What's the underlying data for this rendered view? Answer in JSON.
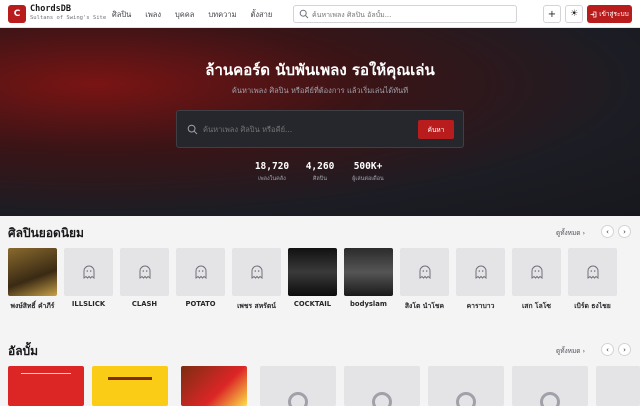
{
  "brand": {
    "logo_letter": "C",
    "name": "ChordsDB",
    "tagline": "Sultans of Swing's Site"
  },
  "nav": [
    "ศิลปิน",
    "เพลง",
    "บุคคล",
    "บทความ",
    "ตั้งสาย"
  ],
  "search": {
    "placeholder": "ค้นหาเพลง ศิลปิน อัลบั้ม..."
  },
  "header_buttons": {
    "add": "+",
    "theme": "☀",
    "login": "เข้าสู่ระบบ"
  },
  "hero": {
    "title": "ล้านคอร์ด นับพันเพลง รอให้คุณเล่น",
    "subtitle": "ค้นหาเพลง ศิลปิน หรือคีย์ที่ต้องการ แล้วเริ่มเล่นได้ทันที",
    "search_placeholder": "ค้นหาเพลง ศิลปิน หรือคีย์...",
    "search_button": "ค้นหา",
    "stats": [
      {
        "value": "18,720",
        "label": "เพลงในคลัง"
      },
      {
        "value": "4,260",
        "label": "ศิลปิน"
      },
      {
        "value": "500K+",
        "label": "ผู้เล่นต่อเดือน"
      }
    ]
  },
  "popular_artists": {
    "title": "ศิลปินยอดนิยม",
    "see_all": "ดูทั้งหมด ›",
    "items": [
      {
        "name": "พงษ์สิทธิ์ คำภีร์",
        "image": "photo"
      },
      {
        "name": "ILLSLICK",
        "image": "placeholder"
      },
      {
        "name": "CLASH",
        "image": "placeholder"
      },
      {
        "name": "POTATO",
        "image": "placeholder"
      },
      {
        "name": "เพชร สหรัตน์",
        "image": "placeholder"
      },
      {
        "name": "COCKTAIL",
        "image": "photo"
      },
      {
        "name": "bodyslam",
        "image": "photo"
      },
      {
        "name": "สิงโต นำโชค",
        "image": "placeholder"
      },
      {
        "name": "คาราบาว",
        "image": "placeholder"
      },
      {
        "name": "เสก โลโซ",
        "image": "placeholder"
      },
      {
        "name": "เบิร์ด ธงไชย",
        "image": "placeholder"
      }
    ]
  },
  "albums": {
    "title": "อัลบั้ม",
    "see_all": "ดูทั้งหมด ›"
  },
  "colors": {
    "accent": "#b91c1c",
    "hero_bg": "#1c1d24"
  }
}
